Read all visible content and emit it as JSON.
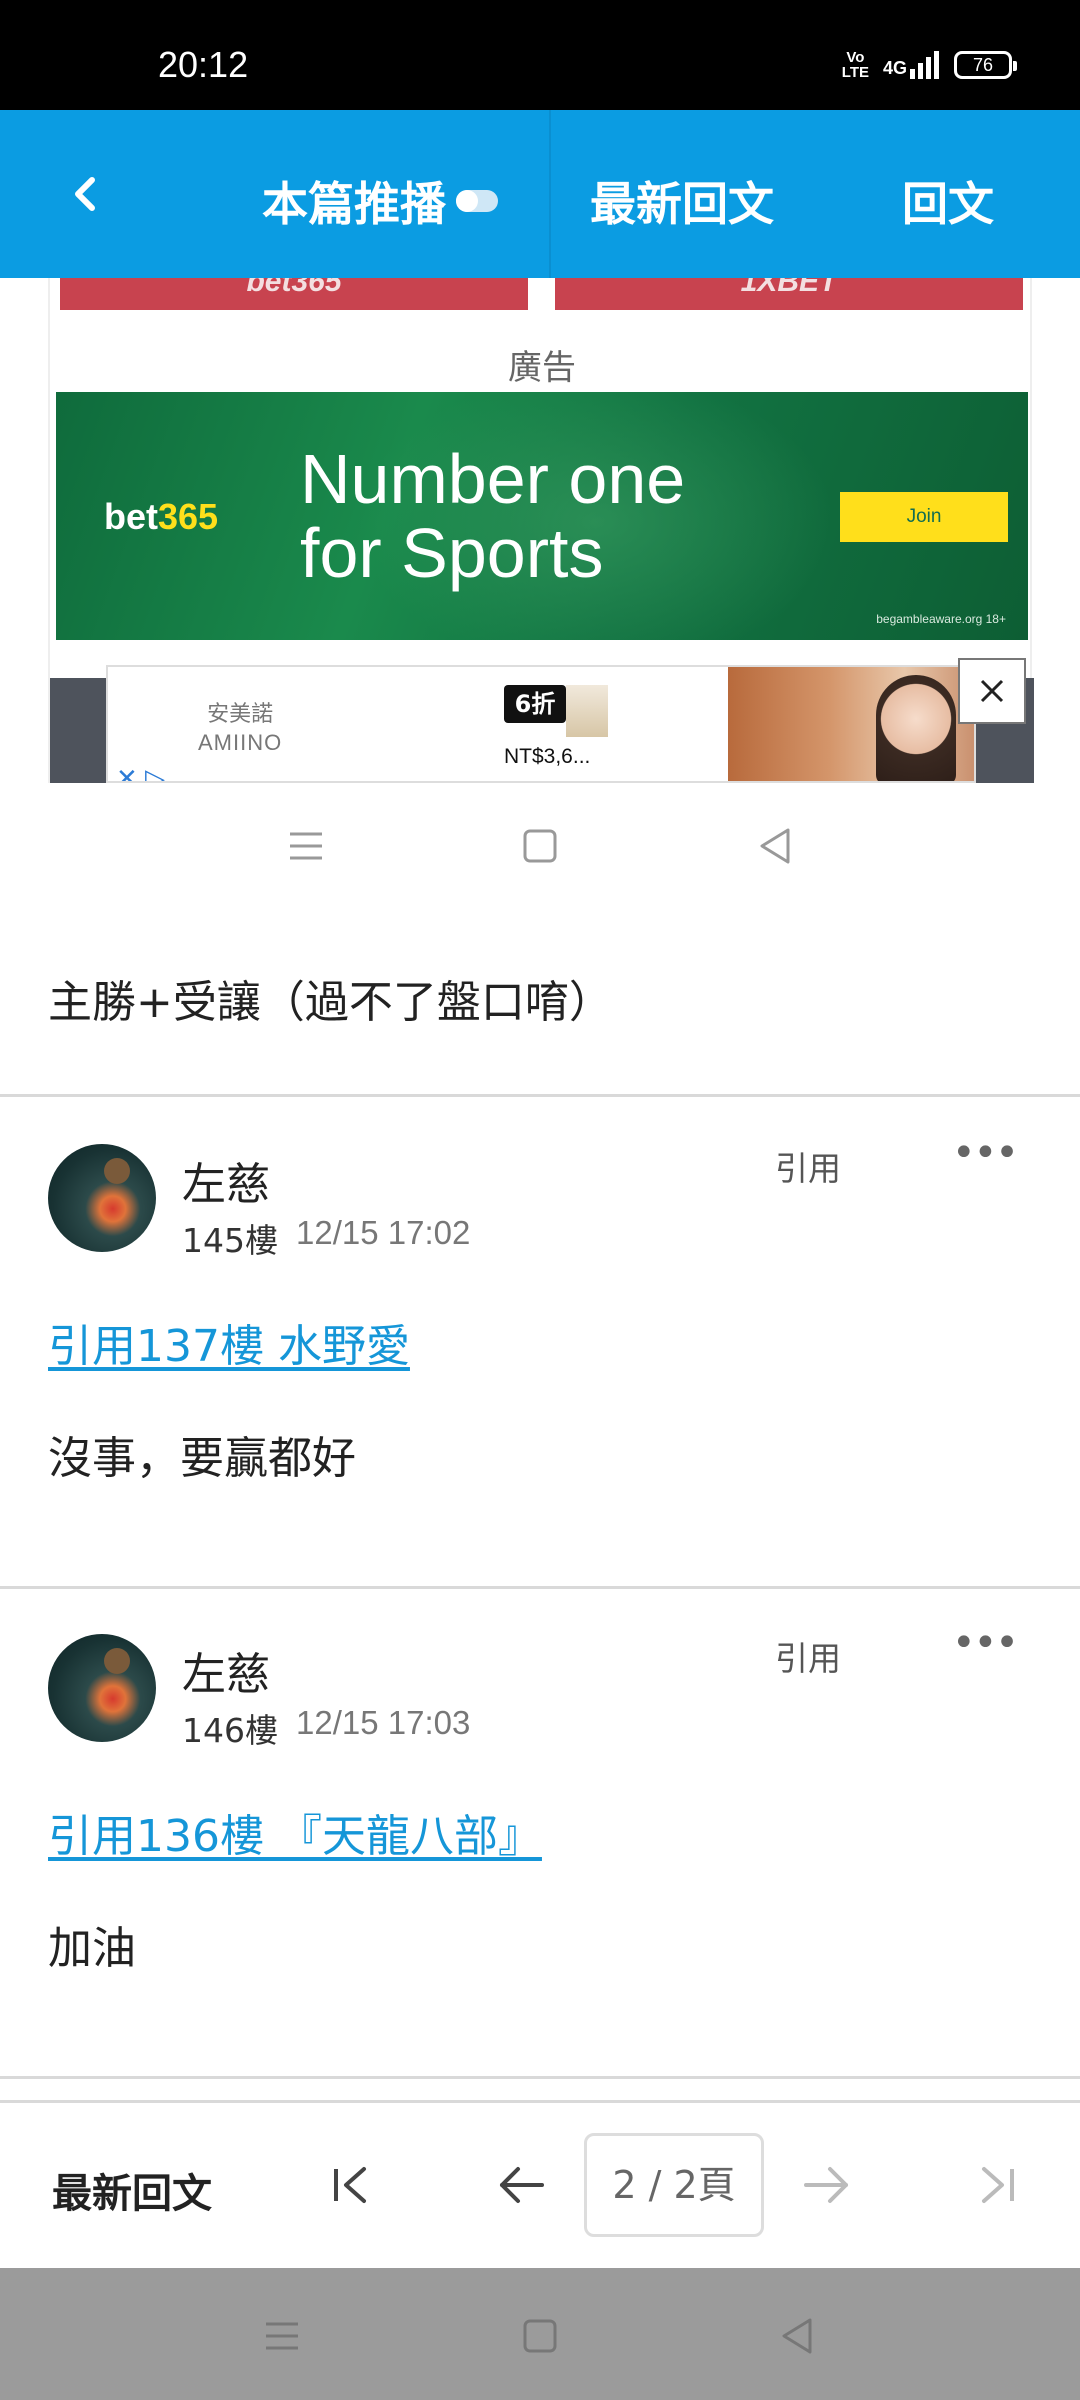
{
  "status_bar": {
    "time": "20:12",
    "volte_top": "Vo",
    "volte_bottom": "LTE",
    "network": "4G",
    "battery": "76"
  },
  "header": {
    "back_icon": "chevron-left-icon",
    "push_label": "本篇推播",
    "latest_label": "最新回文",
    "reply_label": "回文"
  },
  "ad": {
    "label": "廣告",
    "top_left_banner": "bet365",
    "top_right_banner": "1XBET",
    "brand_part1": "bet",
    "brand_part2": "365",
    "slogan_line1": "Number one",
    "slogan_line2": "for Sports",
    "join_label": "Join",
    "gamble_text": "begambleaware.org 18+",
    "amiino_cn": "安美諾",
    "amiino_en": "AMIINO",
    "adchoice": "✕ ▷",
    "promo_badge": "6折",
    "promo_price": "NT$3,6...",
    "close_icon": "close-icon"
  },
  "posts": [
    {
      "body": "主勝+受讓（過不了盤口唷）"
    },
    {
      "username": "左慈",
      "floor": "145樓",
      "time": "12/15 17:02",
      "quote_label": "引用",
      "more_label": "•••",
      "quote_link": "引用137樓 水野愛",
      "body": "沒事，要贏都好"
    },
    {
      "username": "左慈",
      "floor": "146樓",
      "time": "12/15 17:03",
      "quote_label": "引用",
      "more_label": "•••",
      "quote_link": "引用136樓 『天龍八部』",
      "body": "加油"
    }
  ],
  "bottom_bar": {
    "latest_label": "最新回文",
    "page_indicator": "2 / 2頁"
  },
  "colors": {
    "header_blue": "#0b9ce2",
    "link_blue": "#1596d8",
    "bet_green": "#127342",
    "bet_yellow": "#ffdf1b"
  }
}
